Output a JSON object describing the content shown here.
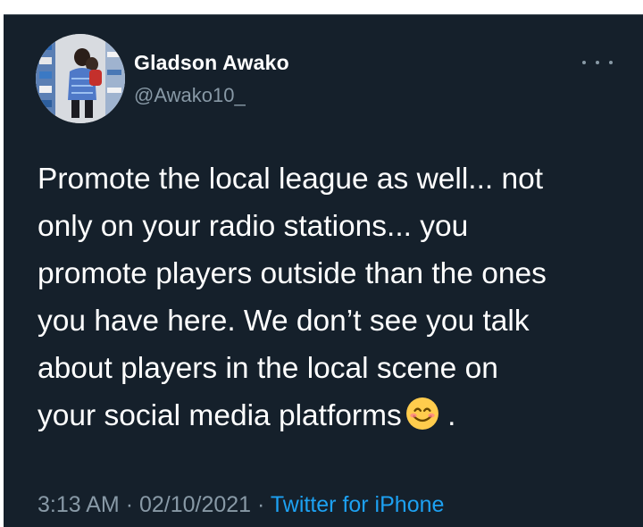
{
  "tweet": {
    "author": {
      "display_name": "Gladson Awako",
      "handle": "@Awako10_",
      "avatar_icon": "user-avatar"
    },
    "more_icon": "more-horizontal-icon",
    "text_lines": [
      "Promote the local league as well... not",
      "only on your radio stations... you",
      "promote players outside than the ones",
      "you have here.  We don’t see you talk",
      "about players in the local scene on",
      "your social media platforms"
    ],
    "text_end_emoji": "smiling-face-emoji",
    "text_end_punct": ".",
    "time": "3:13 AM",
    "separator": "·",
    "date": "02/10/2021",
    "source": "Twitter for iPhone"
  },
  "colors": {
    "background": "#15202b",
    "text": "#ffffff",
    "secondary_text": "#8899a6",
    "link": "#1da1f2"
  }
}
